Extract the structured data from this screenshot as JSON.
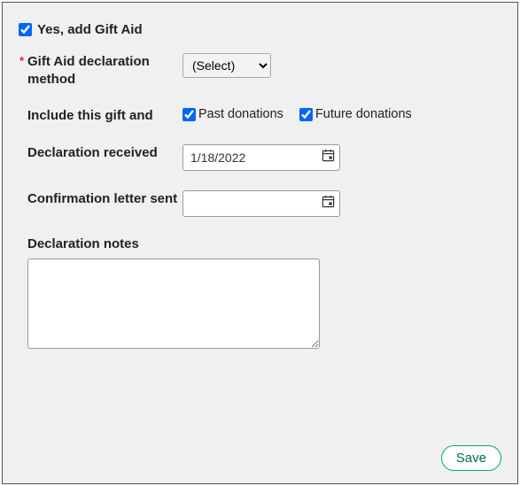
{
  "giftAid": {
    "checkbox_label": "Yes, add Gift Aid",
    "checked": true
  },
  "fields": {
    "method": {
      "label": "Gift Aid declaration method",
      "required_mark": "*",
      "selected": "(Select)"
    },
    "include": {
      "label": "Include this gift and",
      "past": {
        "label": "Past donations",
        "checked": true
      },
      "future": {
        "label": "Future donations",
        "checked": true
      }
    },
    "received": {
      "label": "Declaration received",
      "value": "1/18/2022"
    },
    "confirmation": {
      "label": "Confirmation letter sent",
      "value": ""
    },
    "notes": {
      "label": "Declaration notes",
      "value": ""
    }
  },
  "buttons": {
    "save": "Save"
  }
}
